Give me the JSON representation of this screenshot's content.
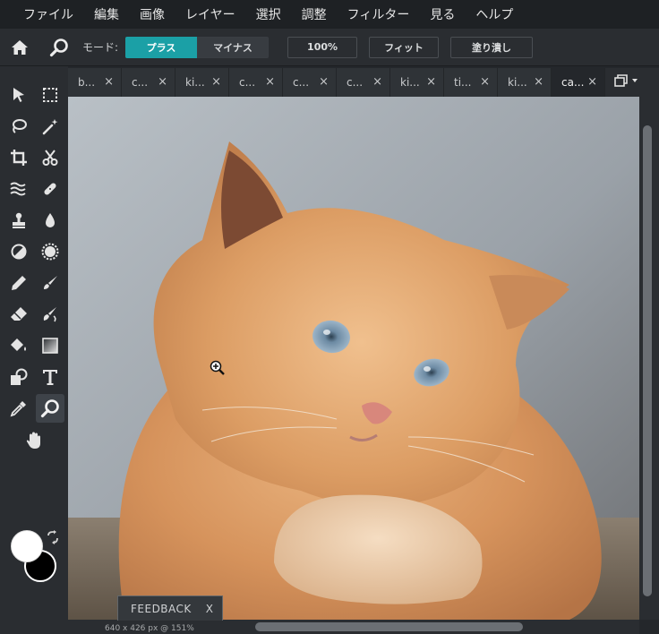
{
  "menubar": {
    "items": [
      "ファイル",
      "編集",
      "画像",
      "レイヤー",
      "選択",
      "調整",
      "フィルター",
      "見る",
      "ヘルプ"
    ]
  },
  "toolbar": {
    "mode_label": "モード:",
    "mode_plus": "プラス",
    "mode_minus": "マイナス",
    "zoom_100": "100%",
    "fit": "フィット",
    "fill": "塗り潰し"
  },
  "tabs": [
    {
      "label": "b..."
    },
    {
      "label": "c..."
    },
    {
      "label": "ki..."
    },
    {
      "label": "c..."
    },
    {
      "label": "c..."
    },
    {
      "label": "c..."
    },
    {
      "label": "ki..."
    },
    {
      "label": "ti..."
    },
    {
      "label": "ki..."
    },
    {
      "label": "ca...",
      "active": true
    }
  ],
  "tab_close_glyph": "×",
  "status": "640 x 426 px @ 151%",
  "feedback": {
    "label": "FEEDBACK",
    "close": "X"
  },
  "colors": {
    "accent": "#1ba0a6",
    "foreground": "#ffffff",
    "background": "#000000"
  },
  "tools": [
    "pointer-icon",
    "marquee-icon",
    "lasso-icon",
    "magic-wand-icon",
    "crop-icon",
    "scissors-icon",
    "liquify-icon",
    "heal-icon",
    "stamp-icon",
    "drop-icon",
    "dodge-icon",
    "sponge-icon",
    "pencil-icon",
    "brush-icon",
    "eraser-icon",
    "smudge-icon",
    "bucket-icon",
    "gradient-icon",
    "shape-icon",
    "text-icon",
    "eyedropper-icon",
    "zoom-icon",
    "hand-icon"
  ]
}
